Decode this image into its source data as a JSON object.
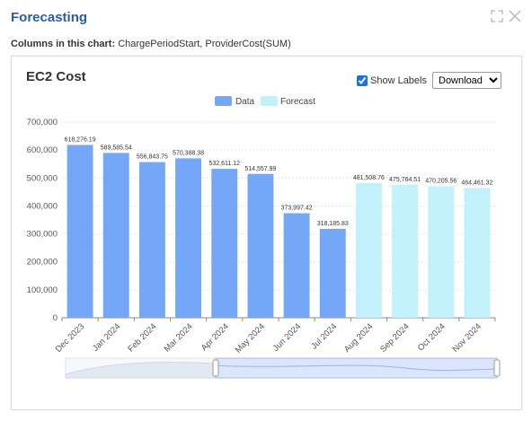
{
  "dialog": {
    "title": "Forecasting",
    "columns_label": "Columns in this chart:",
    "columns_value": "ChargePeriodStart, ProviderCost(SUM)",
    "icons": [
      "expand-icon",
      "close-icon"
    ]
  },
  "chart_header": {
    "title": "EC2 Cost",
    "show_labels_text": "Show Labels",
    "show_labels_checked": true,
    "download_selected": "Download"
  },
  "colors": {
    "data": "#74a7f7",
    "forecast": "#c2f0fb",
    "title": "#2a5ea3"
  },
  "chart_data": {
    "type": "bar",
    "title": "",
    "xlabel": "",
    "ylabel": "",
    "ylim": [
      0,
      700000
    ],
    "yticks": [
      "0",
      "100,000",
      "200,000",
      "300,000",
      "400,000",
      "500,000",
      "600,000",
      "700,000"
    ],
    "categories": [
      "Dec 2023",
      "Jan 2024",
      "Feb 2024",
      "Mar 2024",
      "Apr 2024",
      "May 2024",
      "Jun 2024",
      "Jul 2024",
      "Aug 2024",
      "Sep 2024",
      "Oct 2024",
      "Nov 2024"
    ],
    "series": [
      {
        "name": "Data",
        "values": [
          618276.19,
          589585.54,
          556843.75,
          570388.38,
          532611.12,
          514557.99,
          373997.42,
          318185.83,
          null,
          null,
          null,
          null
        ]
      },
      {
        "name": "Forecast",
        "values": [
          null,
          null,
          null,
          null,
          null,
          null,
          null,
          null,
          481508.76,
          475764.51,
          470205.56,
          464461.32
        ]
      }
    ],
    "labels": [
      "618,276.19",
      "589,585.54",
      "556,843.75",
      "570,388.38",
      "532,611.12",
      "514,557.99",
      "373,997.42",
      "318,185.83",
      "481,508.76",
      "475,764.51",
      "470,205.56",
      "464,461.32"
    ],
    "grid": true,
    "legend": "top-center"
  }
}
